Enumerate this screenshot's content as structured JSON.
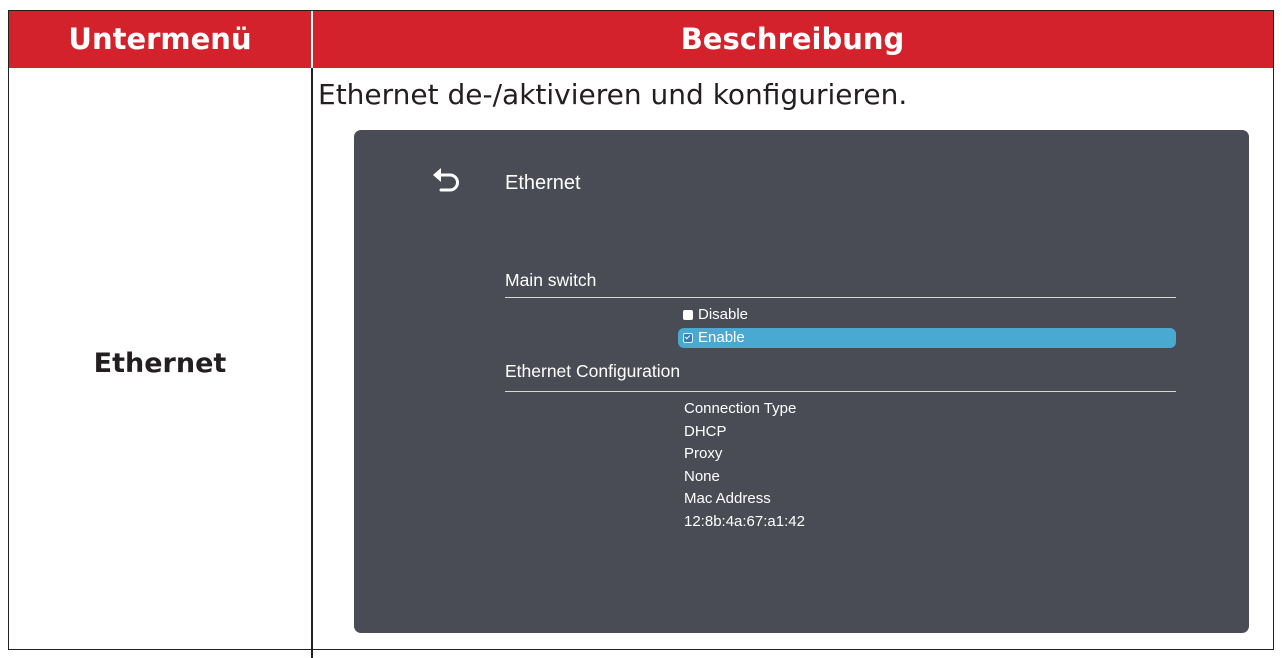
{
  "table": {
    "header_col1": "Untermenü",
    "header_col2": "Beschreibung",
    "row_label": "Ethernet",
    "description": "Ethernet de-/aktivieren und konfigurieren."
  },
  "panel": {
    "title": "Ethernet",
    "main_switch_title": "Main switch",
    "options": [
      {
        "label": "Disable",
        "selected": false
      },
      {
        "label": "Enable",
        "selected": true
      }
    ],
    "config_title": "Ethernet Configuration",
    "info": [
      "Connection Type",
      "DHCP",
      "Proxy",
      "None",
      "Mac Address",
      "12:8b:4a:67:a1:42"
    ]
  },
  "colors": {
    "header_bg": "#d3222c",
    "panel_bg": "#4a4c55",
    "highlight": "#49a9d0"
  },
  "icons": {
    "back": "back-arrow-icon"
  }
}
